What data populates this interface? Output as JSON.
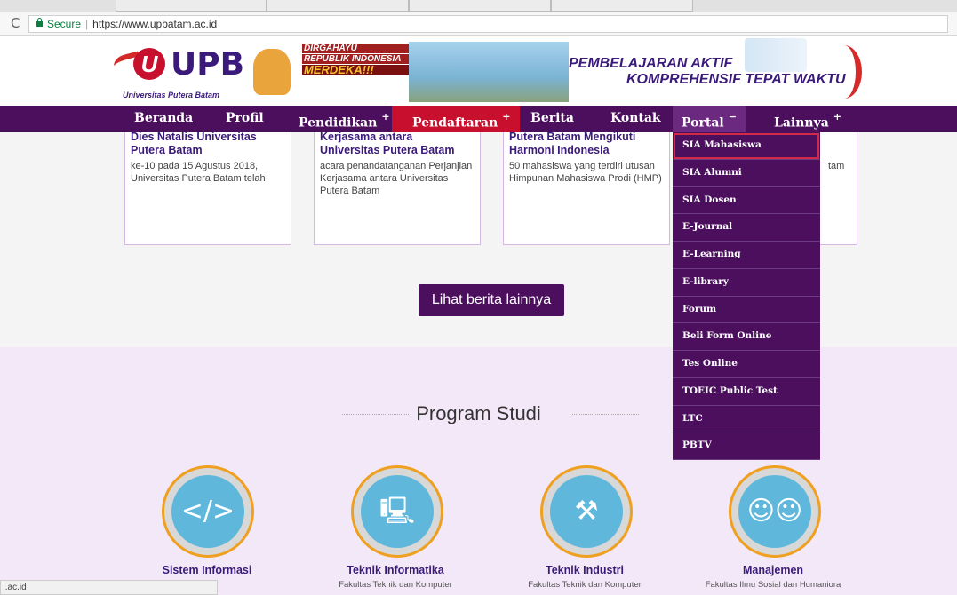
{
  "browser": {
    "url_secure_label": "Secure",
    "url": "https://www.upbatam.ac.id",
    "status_url": " .ac.id"
  },
  "banner": {
    "logo_text": "UPB",
    "logo_sub": "Universitas Putera Batam",
    "dirgahayu_line1": "DIRGAHAYU",
    "dirgahayu_line2": "REPUBLIK INDONESIA",
    "dirgahayu_line3": "MERDEKA!!!",
    "slogan_line1": "PEMBELAJARAN AKTIF",
    "slogan_line2": "KOMPREHENSIF TEPAT WAKTU"
  },
  "nav": {
    "items": [
      {
        "label": "Beranda",
        "plus": ""
      },
      {
        "label": "Profil",
        "plus": ""
      },
      {
        "label": "Pendidikan",
        "plus": "+"
      },
      {
        "label": "Pendaftaran",
        "plus": "+"
      },
      {
        "label": "Berita",
        "plus": ""
      },
      {
        "label": "Kontak",
        "plus": ""
      },
      {
        "label": "Portal",
        "plus": "−"
      },
      {
        "label": "Lainnya",
        "plus": "+"
      }
    ]
  },
  "news": [
    {
      "title": "Dies Natalis Universitas Putera Batam",
      "text": "ke-10 pada 15 Agustus 2018, Universitas Putera Batam telah"
    },
    {
      "title": "Kerjasama antara Universitas Putera Batam",
      "text": "acara penandatanganan Perjanjian Kerjasama antara Universitas Putera Batam"
    },
    {
      "title": "Putera Batam Mengikuti Harmoni Indonesia",
      "text": "50 mahasiswa yang terdiri utusan Himpunan Mahasiswa Prodi (HMP)"
    },
    {
      "title": "",
      "text": "tam"
    }
  ],
  "more_news_button": "Lihat berita lainnya",
  "portal_menu": [
    "SIA Mahasiswa",
    "SIA Alumni",
    "SIA Dosen",
    "E-Journal",
    "E-Learning",
    "E-library",
    "Forum",
    "Beli Form Online",
    "Tes Online",
    "TOEIC Public Test",
    "LTC",
    "PBTV"
  ],
  "program_studi": {
    "title": "Program Studi",
    "items": [
      {
        "name": "Sistem Informasi",
        "faculty": "",
        "icon": "code-window-icon"
      },
      {
        "name": "Teknik Informatika",
        "faculty": "Fakultas Teknik dan Komputer",
        "icon": "computer-network-icon"
      },
      {
        "name": "Teknik Industri",
        "faculty": "Fakultas Teknik dan Komputer",
        "icon": "oil-pump-icon"
      },
      {
        "name": "Manajemen",
        "faculty": "Fakultas Ilmu Sosial dan Humaniora",
        "icon": "people-group-icon"
      }
    ]
  },
  "colors": {
    "nav_bg": "#4b0f5e",
    "active_red": "#c8102e",
    "prodi_bg": "#f3e8f8"
  }
}
